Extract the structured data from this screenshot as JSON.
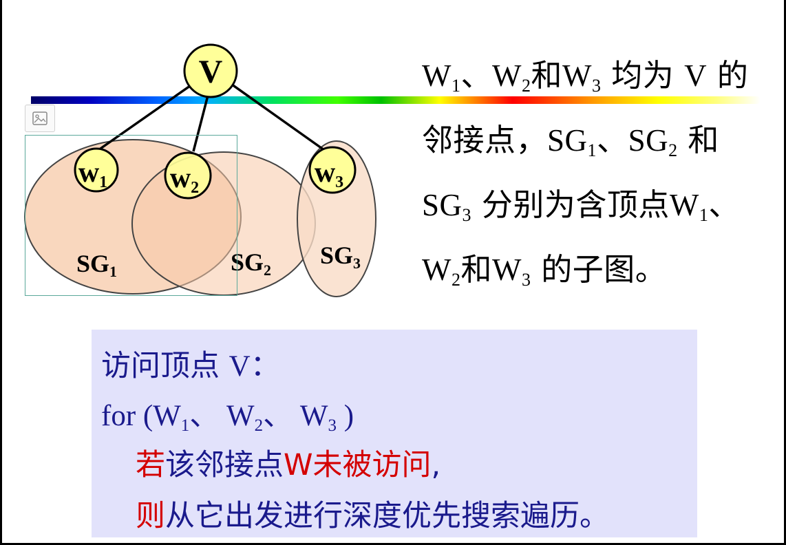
{
  "graph": {
    "root_label": "V",
    "children": [
      {
        "letter": "w",
        "sub": "1"
      },
      {
        "letter": "w",
        "sub": "2"
      },
      {
        "letter": "w",
        "sub": "3"
      }
    ],
    "subgraphs": [
      {
        "label": "SG",
        "sub": "1"
      },
      {
        "label": "SG",
        "sub": "2"
      },
      {
        "label": "SG",
        "sub": "3"
      }
    ],
    "colors": {
      "node_fill": "#ffff99",
      "subgraph_fill": "#f7c9a8",
      "subgraph_stroke": "#444444"
    }
  },
  "description": {
    "line1": {
      "w1": "W",
      "s1": "1",
      "sep1": "、",
      "w2": "W",
      "s2": "2",
      "and": "和",
      "w3": "W",
      "s3": "3",
      "mid": " 均为 ",
      "v": "V",
      "end": " 的"
    },
    "line2": {
      "a": "邻接点，",
      "sg1": "SG",
      "s1": "1",
      "sep": "、",
      "sg2": "SG",
      "s2": "2",
      "end": " 和"
    },
    "line3": {
      "sg3": "SG",
      "s3": "3",
      "mid": " 分别为含顶点",
      "w1": "W",
      "s1": "1",
      "end": "、"
    },
    "line4": {
      "w2": "W",
      "s2": "2",
      "and": "和",
      "w3": "W",
      "s3": "3",
      "end": " 的子图。"
    }
  },
  "code": {
    "line1": {
      "a": "访问顶点 ",
      "v": "V",
      "b": "："
    },
    "line2": {
      "a": "for (W",
      "s1": "1",
      "b": "、 W",
      "s2": "2",
      "c": "、 W",
      "s3": "3",
      "d": " )"
    },
    "line3": {
      "red1": "若",
      "a": "该邻接点",
      "red2": "W未被访问",
      "b": ","
    },
    "line4": {
      "red1": "则",
      "a": "从它出发进行深度优先搜索遍历。"
    }
  },
  "accent_colors": {
    "code_text": "#1a1a8c",
    "highlight": "#d40000",
    "code_bg": "#e2e2fb"
  },
  "icons": {
    "placeholder": "image-placeholder-icon"
  }
}
